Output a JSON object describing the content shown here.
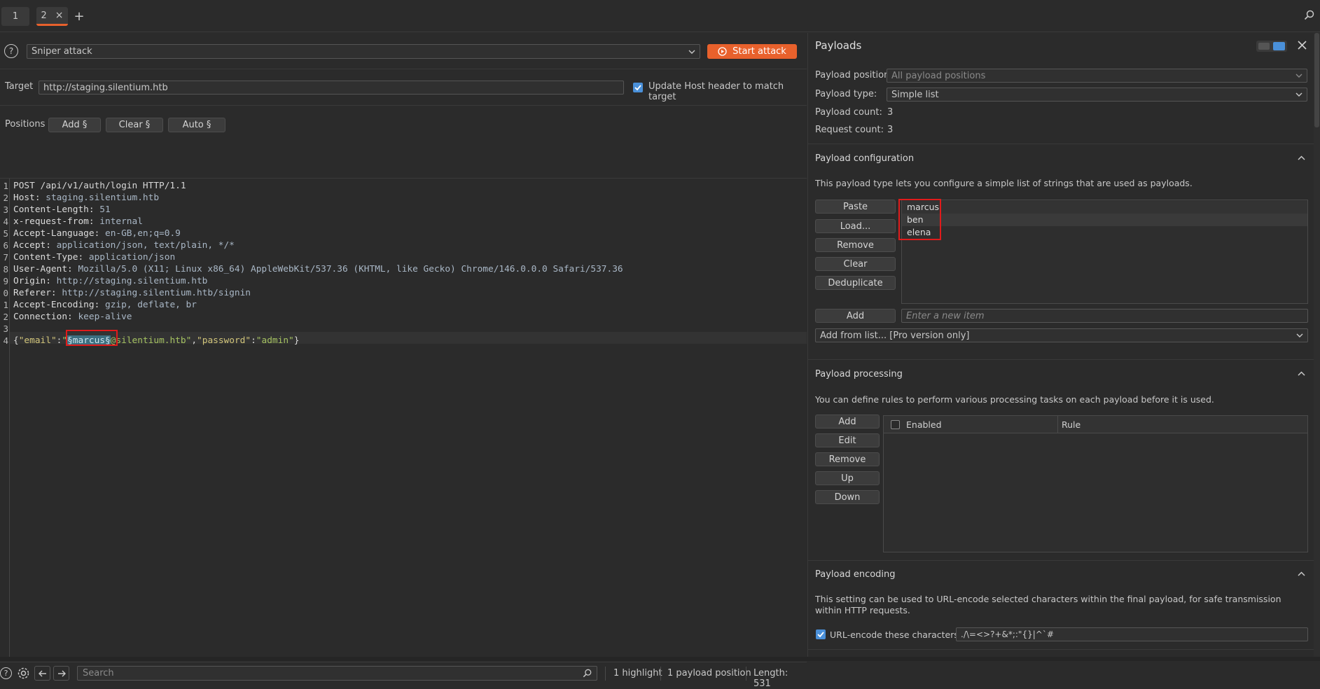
{
  "tabs": [
    {
      "label": "1"
    },
    {
      "label": "2",
      "close": "×"
    }
  ],
  "add_tab_label": "+",
  "attack": {
    "help_icon": "?",
    "attack_type": "Sniper attack",
    "start_label": "Start attack"
  },
  "target": {
    "label": "Target",
    "value": "http://staging.silentium.htb",
    "update_host_label": "Update Host header to match target",
    "update_host_checked": true
  },
  "positions": {
    "label": "Positions",
    "add_label": "Add §",
    "clear_label": "Clear §",
    "auto_label": "Auto §"
  },
  "request": {
    "line_numbers": [
      "1",
      "2",
      "3",
      "4",
      "5",
      "6",
      "7",
      "8",
      "9",
      "0",
      "1",
      "2",
      "3",
      "4"
    ],
    "lines": [
      {
        "type": "first",
        "text": "POST /api/v1/auth/login HTTP/1.1"
      },
      {
        "type": "header",
        "name": "Host:",
        "value": " staging.silentium.htb"
      },
      {
        "type": "header",
        "name": "Content-Length:",
        "value": " 51"
      },
      {
        "type": "header",
        "name": "x-request-from:",
        "value": " internal"
      },
      {
        "type": "header",
        "name": "Accept-Language:",
        "value": " en-GB,en;q=0.9"
      },
      {
        "type": "header",
        "name": "Accept:",
        "value": " application/json, text/plain, */*"
      },
      {
        "type": "header",
        "name": "Content-Type:",
        "value": " application/json"
      },
      {
        "type": "header",
        "name": "User-Agent:",
        "value": " Mozilla/5.0 (X11; Linux x86_64) AppleWebKit/537.36 (KHTML, like Gecko) Chrome/146.0.0.0 Safari/537.36"
      },
      {
        "type": "header",
        "name": "Origin:",
        "value": " http://staging.silentium.htb"
      },
      {
        "type": "header",
        "name": "Referer:",
        "value": " http://staging.silentium.htb/signin"
      },
      {
        "type": "header",
        "name": "Accept-Encoding:",
        "value": " gzip, deflate, br"
      },
      {
        "type": "header",
        "name": "Connection:",
        "value": " keep-alive"
      },
      {
        "type": "blank",
        "text": ""
      }
    ],
    "body": {
      "open": "{",
      "key1": "\"email\"",
      "colon": ":",
      "quote": "\"",
      "marker": "§marcus§",
      "rest1": "@silentium.htb\"",
      "comma": ",",
      "key2": "\"password\"",
      "val2": "\"admin\"",
      "close": "}"
    }
  },
  "footer": {
    "search_placeholder": "Search",
    "highlights": "1 highlight",
    "payload_positions": "1 payload position",
    "length": "Length: 531"
  },
  "payloads": {
    "title": "Payloads",
    "position_label": "Payload position:",
    "position_value": "All payload positions",
    "type_label": "Payload type:",
    "type_value": "Simple list",
    "count_label": "Payload count:",
    "count_value": "3",
    "request_count_label": "Request count:",
    "request_count_value": "3"
  },
  "config": {
    "title": "Payload configuration",
    "description": "This payload type lets you configure a simple list of strings that are used as payloads.",
    "buttons": [
      "Paste",
      "Load...",
      "Remove",
      "Clear",
      "Deduplicate"
    ],
    "items": [
      "marcus",
      "ben",
      "elena"
    ],
    "add_label": "Add",
    "new_item_placeholder": "Enter a new item",
    "add_from_list": "Add from list... [Pro version only]"
  },
  "processing": {
    "title": "Payload processing",
    "description": "You can define rules to perform various processing tasks on each payload before it is used.",
    "buttons": [
      "Add",
      "Edit",
      "Remove",
      "Up",
      "Down"
    ],
    "col_enabled": "Enabled",
    "col_rule": "Rule"
  },
  "encoding": {
    "title": "Payload encoding",
    "description": "This setting can be used to URL-encode selected characters within the final payload, for safe transmission within HTTP requests.",
    "url_encode_label": "URL-encode these characters:",
    "url_encode_checked": true,
    "chars": "./\\=<>?+&*;:\"{}|^`#"
  },
  "colors": {
    "accent": "#e8612c",
    "highlight_box": "#e01b1b",
    "checkbox": "#4a90d9"
  }
}
